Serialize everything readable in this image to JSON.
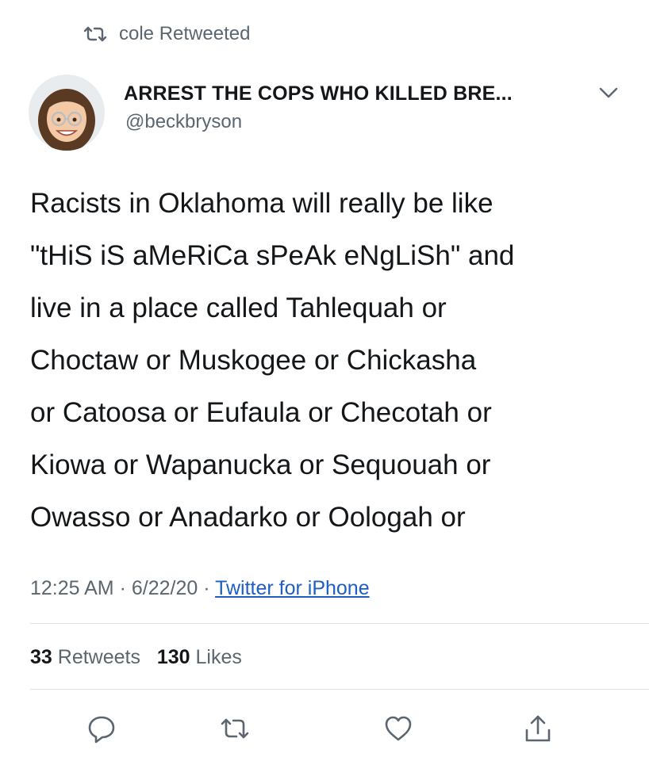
{
  "retweet_context": {
    "icon": "retweet-icon",
    "text": "cole Retweeted"
  },
  "author": {
    "display_name": "ARREST THE COPS WHO KILLED BRE...",
    "handle": "@beckbryson",
    "avatar": "memoji-avatar"
  },
  "tweet": {
    "lines": [
      "Racists in Oklahoma will really be like",
      "\"tHiS iS aMeRiCa sPeAk eNgLiSh\" and",
      "live in a place called Tahlequah or",
      "Choctaw or Muskogee or Chickasha",
      "or Catoosa or Eufaula or Checotah or",
      "Kiowa or Wapanucka or Sequouah or",
      "Owasso or Anadarko or Oologah or"
    ]
  },
  "meta": {
    "time": "12:25 AM",
    "sep": "·",
    "date": "6/22/20",
    "source": "Twitter for iPhone"
  },
  "stats": {
    "retweets_count": "33",
    "retweets_label": "Retweets",
    "likes_count": "130",
    "likes_label": "Likes"
  },
  "actions": [
    "reply-icon",
    "retweet-icon",
    "like-icon",
    "share-icon"
  ],
  "colors": {
    "text": "#14171a",
    "secondary": "#5b6670",
    "link": "#1d5fc4",
    "divider": "#dfe3e7"
  }
}
